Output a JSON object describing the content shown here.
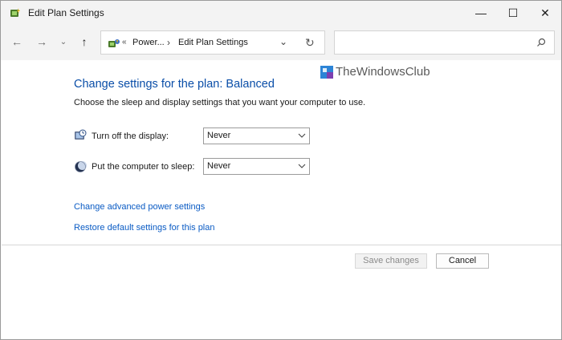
{
  "window": {
    "title": "Edit Plan Settings",
    "controls": {
      "minimize": "—",
      "maximize": "☐",
      "close": "✕"
    }
  },
  "navigation": {
    "back": "←",
    "forward": "→",
    "recent": "⌄",
    "up": "↑",
    "address": {
      "separator1": "«",
      "crumb1": "Power...",
      "separator2": "›",
      "crumb2": "Edit Plan Settings",
      "dropdown": "⌄",
      "refresh": "↻"
    },
    "search_placeholder": ""
  },
  "watermark": {
    "text": "TheWindowsClub"
  },
  "main": {
    "heading": "Change settings for the plan: Balanced",
    "description": "Choose the sleep and display settings that you want your computer to use.",
    "settings": [
      {
        "label": "Turn off the display:",
        "value": "Never",
        "icon": "display-clock-icon"
      },
      {
        "label": "Put the computer to sleep:",
        "value": "Never",
        "icon": "sleep-moon-icon"
      }
    ],
    "links": {
      "advanced": "Change advanced power settings",
      "restore": "Restore default settings for this plan"
    }
  },
  "footer": {
    "save_label": "Save changes",
    "cancel_label": "Cancel"
  },
  "colors": {
    "heading": "#0a4ea8",
    "link": "#0a5bc4",
    "chrome": "#f3f3f3"
  }
}
